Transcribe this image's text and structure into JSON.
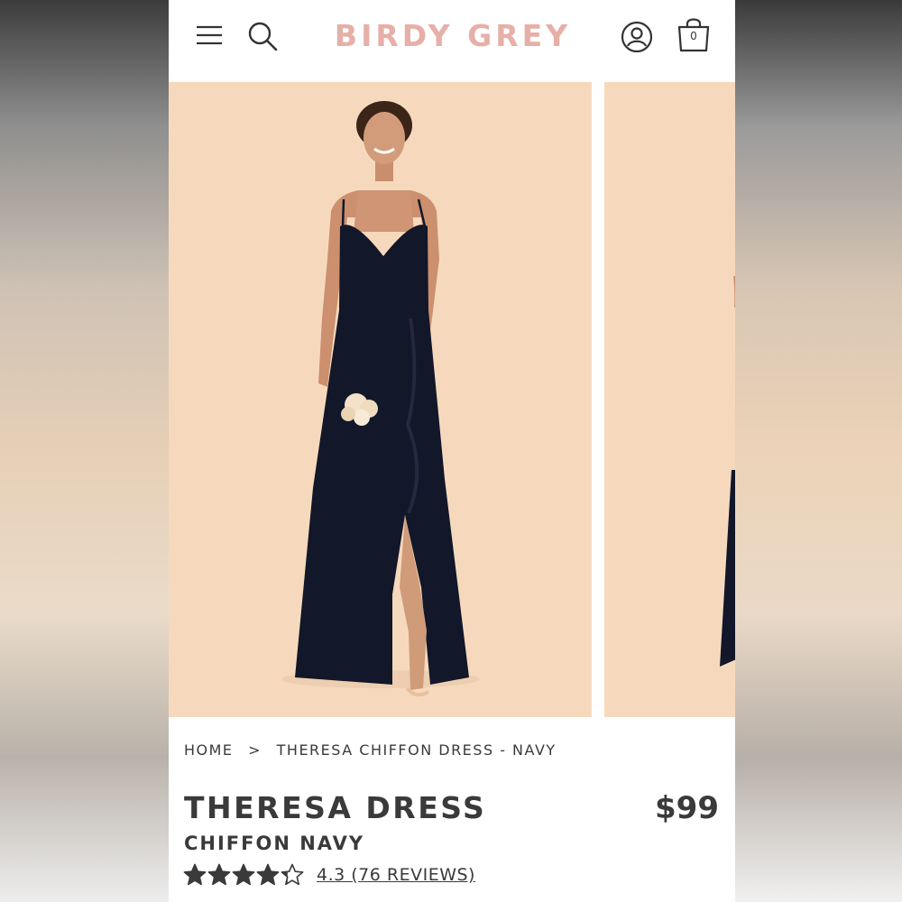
{
  "header": {
    "logo": "BIRDY GREY",
    "bag_count": "0",
    "menu_icon": "hamburger-menu-icon",
    "search_icon": "search-icon",
    "account_icon": "account-icon",
    "bag_icon": "shopping-bag-icon"
  },
  "gallery": {
    "background_color": "#f6d9bd",
    "dress_color": "#121729"
  },
  "breadcrumb": {
    "home": "HOME",
    "separator": ">",
    "current": "THERESA CHIFFON DRESS - NAVY"
  },
  "product": {
    "name": "THERESA DRESS",
    "variant": "CHIFFON NAVY",
    "price": "$99",
    "rating_value": 4.3,
    "rating_max": 5,
    "rating_text": "4.3 (76 REVIEWS)"
  },
  "colors": {
    "logo": "#e6afa7",
    "text": "#3a3a3a"
  }
}
